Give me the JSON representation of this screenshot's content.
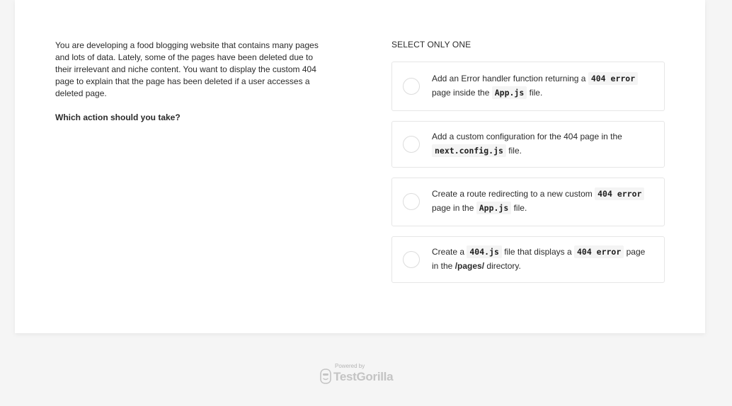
{
  "question": {
    "text": "You are developing a food blogging website that contains many pages and lots of data. Lately, some of the pages have been deleted due to their irrelevant and niche content. You want to display the custom 404 page to explain that the page has been deleted if a user accesses a deleted page.",
    "ask": "Which action should you take?"
  },
  "answers": {
    "select_label": "SELECT ONLY ONE",
    "options": [
      {
        "parts": [
          {
            "t": "Add an Error handler function returning a "
          },
          {
            "t": "404 error",
            "code": true
          },
          {
            "t": " page inside the "
          },
          {
            "t": "App.js",
            "code": true
          },
          {
            "t": " file."
          }
        ]
      },
      {
        "parts": [
          {
            "t": "Add a custom configuration for the 404 page in the "
          },
          {
            "t": "next.config.js",
            "code": true
          },
          {
            "t": " file."
          }
        ]
      },
      {
        "parts": [
          {
            "t": "Create a route redirecting to a new custom "
          },
          {
            "t": "404 error",
            "code": true
          },
          {
            "t": " page in the "
          },
          {
            "t": "App.js",
            "code": true
          },
          {
            "t": " file."
          }
        ]
      },
      {
        "parts": [
          {
            "t": "Create a "
          },
          {
            "t": "404.js",
            "code": true
          },
          {
            "t": " file that displays a "
          },
          {
            "t": "404 error",
            "code": true
          },
          {
            "t": " page in the "
          },
          {
            "t": "/pages/",
            "bold": true
          },
          {
            "t": " directory."
          }
        ]
      }
    ]
  },
  "footer": {
    "powered_by": "Powered by",
    "brand": "TestGorilla",
    "logo_icon": "gorilla-logo-icon"
  }
}
